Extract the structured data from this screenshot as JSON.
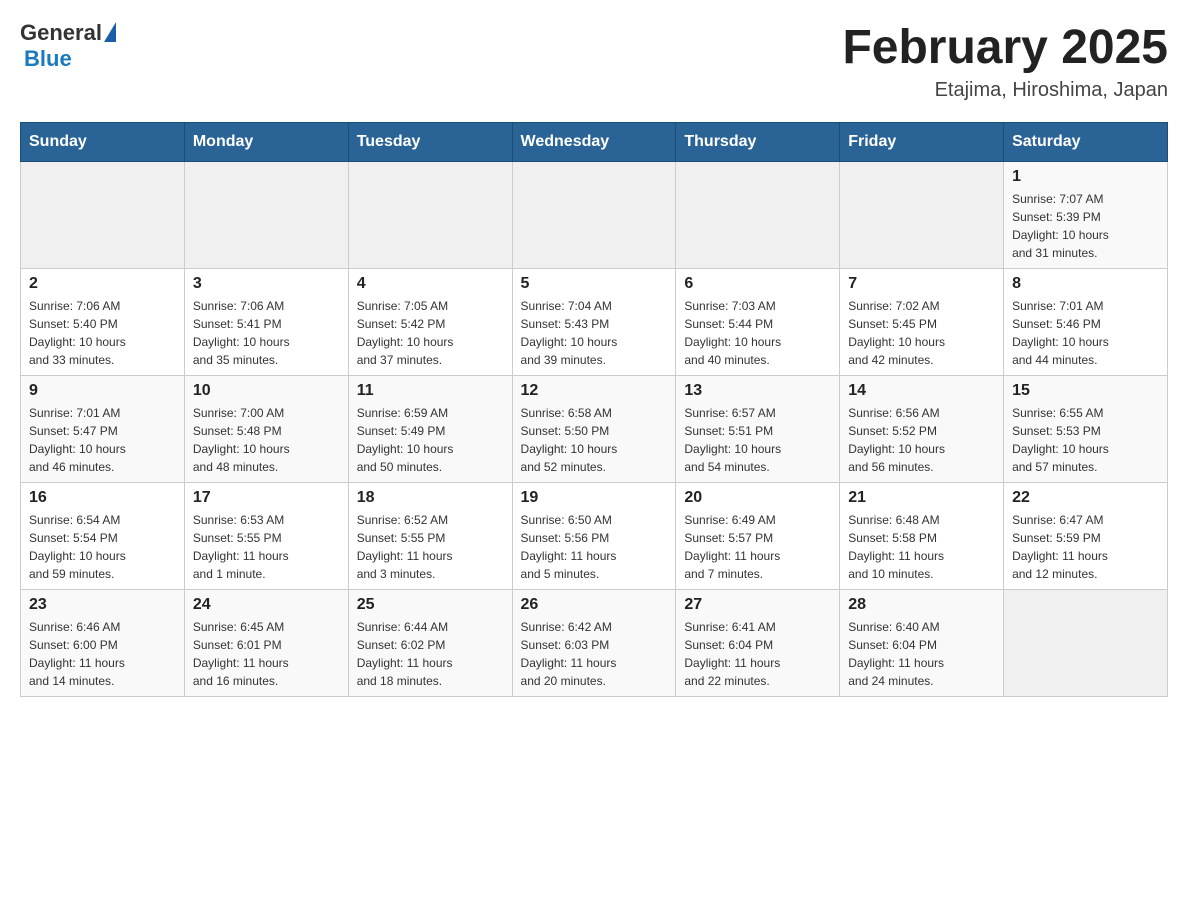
{
  "header": {
    "month_title": "February 2025",
    "location": "Etajima, Hiroshima, Japan",
    "logo_general": "General",
    "logo_blue": "Blue"
  },
  "weekdays": [
    "Sunday",
    "Monday",
    "Tuesday",
    "Wednesday",
    "Thursday",
    "Friday",
    "Saturday"
  ],
  "weeks": [
    [
      {
        "day": "",
        "info": ""
      },
      {
        "day": "",
        "info": ""
      },
      {
        "day": "",
        "info": ""
      },
      {
        "day": "",
        "info": ""
      },
      {
        "day": "",
        "info": ""
      },
      {
        "day": "",
        "info": ""
      },
      {
        "day": "1",
        "info": "Sunrise: 7:07 AM\nSunset: 5:39 PM\nDaylight: 10 hours\nand 31 minutes."
      }
    ],
    [
      {
        "day": "2",
        "info": "Sunrise: 7:06 AM\nSunset: 5:40 PM\nDaylight: 10 hours\nand 33 minutes."
      },
      {
        "day": "3",
        "info": "Sunrise: 7:06 AM\nSunset: 5:41 PM\nDaylight: 10 hours\nand 35 minutes."
      },
      {
        "day": "4",
        "info": "Sunrise: 7:05 AM\nSunset: 5:42 PM\nDaylight: 10 hours\nand 37 minutes."
      },
      {
        "day": "5",
        "info": "Sunrise: 7:04 AM\nSunset: 5:43 PM\nDaylight: 10 hours\nand 39 minutes."
      },
      {
        "day": "6",
        "info": "Sunrise: 7:03 AM\nSunset: 5:44 PM\nDaylight: 10 hours\nand 40 minutes."
      },
      {
        "day": "7",
        "info": "Sunrise: 7:02 AM\nSunset: 5:45 PM\nDaylight: 10 hours\nand 42 minutes."
      },
      {
        "day": "8",
        "info": "Sunrise: 7:01 AM\nSunset: 5:46 PM\nDaylight: 10 hours\nand 44 minutes."
      }
    ],
    [
      {
        "day": "9",
        "info": "Sunrise: 7:01 AM\nSunset: 5:47 PM\nDaylight: 10 hours\nand 46 minutes."
      },
      {
        "day": "10",
        "info": "Sunrise: 7:00 AM\nSunset: 5:48 PM\nDaylight: 10 hours\nand 48 minutes."
      },
      {
        "day": "11",
        "info": "Sunrise: 6:59 AM\nSunset: 5:49 PM\nDaylight: 10 hours\nand 50 minutes."
      },
      {
        "day": "12",
        "info": "Sunrise: 6:58 AM\nSunset: 5:50 PM\nDaylight: 10 hours\nand 52 minutes."
      },
      {
        "day": "13",
        "info": "Sunrise: 6:57 AM\nSunset: 5:51 PM\nDaylight: 10 hours\nand 54 minutes."
      },
      {
        "day": "14",
        "info": "Sunrise: 6:56 AM\nSunset: 5:52 PM\nDaylight: 10 hours\nand 56 minutes."
      },
      {
        "day": "15",
        "info": "Sunrise: 6:55 AM\nSunset: 5:53 PM\nDaylight: 10 hours\nand 57 minutes."
      }
    ],
    [
      {
        "day": "16",
        "info": "Sunrise: 6:54 AM\nSunset: 5:54 PM\nDaylight: 10 hours\nand 59 minutes."
      },
      {
        "day": "17",
        "info": "Sunrise: 6:53 AM\nSunset: 5:55 PM\nDaylight: 11 hours\nand 1 minute."
      },
      {
        "day": "18",
        "info": "Sunrise: 6:52 AM\nSunset: 5:55 PM\nDaylight: 11 hours\nand 3 minutes."
      },
      {
        "day": "19",
        "info": "Sunrise: 6:50 AM\nSunset: 5:56 PM\nDaylight: 11 hours\nand 5 minutes."
      },
      {
        "day": "20",
        "info": "Sunrise: 6:49 AM\nSunset: 5:57 PM\nDaylight: 11 hours\nand 7 minutes."
      },
      {
        "day": "21",
        "info": "Sunrise: 6:48 AM\nSunset: 5:58 PM\nDaylight: 11 hours\nand 10 minutes."
      },
      {
        "day": "22",
        "info": "Sunrise: 6:47 AM\nSunset: 5:59 PM\nDaylight: 11 hours\nand 12 minutes."
      }
    ],
    [
      {
        "day": "23",
        "info": "Sunrise: 6:46 AM\nSunset: 6:00 PM\nDaylight: 11 hours\nand 14 minutes."
      },
      {
        "day": "24",
        "info": "Sunrise: 6:45 AM\nSunset: 6:01 PM\nDaylight: 11 hours\nand 16 minutes."
      },
      {
        "day": "25",
        "info": "Sunrise: 6:44 AM\nSunset: 6:02 PM\nDaylight: 11 hours\nand 18 minutes."
      },
      {
        "day": "26",
        "info": "Sunrise: 6:42 AM\nSunset: 6:03 PM\nDaylight: 11 hours\nand 20 minutes."
      },
      {
        "day": "27",
        "info": "Sunrise: 6:41 AM\nSunset: 6:04 PM\nDaylight: 11 hours\nand 22 minutes."
      },
      {
        "day": "28",
        "info": "Sunrise: 6:40 AM\nSunset: 6:04 PM\nDaylight: 11 hours\nand 24 minutes."
      },
      {
        "day": "",
        "info": ""
      }
    ]
  ]
}
